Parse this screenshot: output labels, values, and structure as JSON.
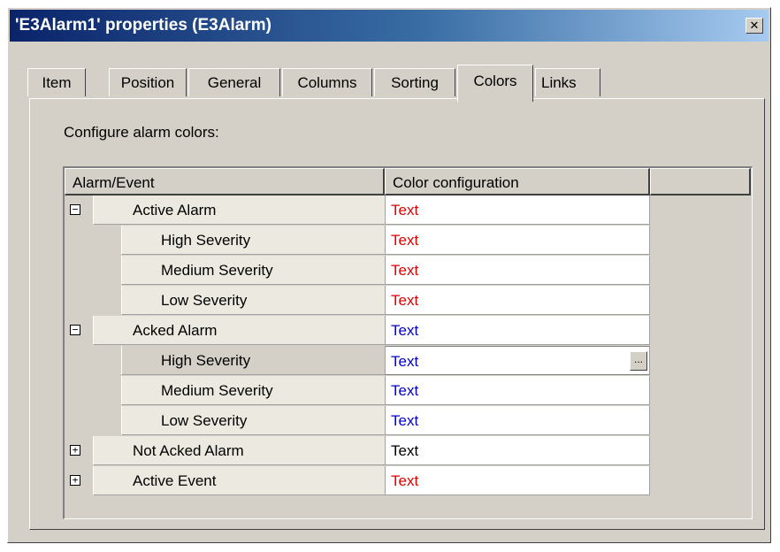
{
  "window": {
    "title": "'E3Alarm1' properties (E3Alarm)",
    "close_glyph": "✕"
  },
  "tabs": [
    {
      "label": "Item"
    },
    {
      "label": "Position"
    },
    {
      "label": "General"
    },
    {
      "label": "Columns"
    },
    {
      "label": "Sorting"
    },
    {
      "label": "Colors"
    },
    {
      "label": "Links"
    }
  ],
  "active_tab": "Colors",
  "panel": {
    "configure_label": "Configure alarm colors:"
  },
  "grid": {
    "headers": [
      "Alarm/Event",
      "Color configuration"
    ],
    "rows": [
      {
        "name": "Active Alarm",
        "level": 0,
        "expander": "−",
        "color_text": "Text",
        "color": "#e00000"
      },
      {
        "name": "High Severity",
        "level": 1,
        "color_text": "Text",
        "color": "#e00000"
      },
      {
        "name": "Medium Severity",
        "level": 1,
        "color_text": "Text",
        "color": "#e00000"
      },
      {
        "name": "Low Severity",
        "level": 1,
        "color_text": "Text",
        "color": "#e00000"
      },
      {
        "name": "Acked Alarm",
        "level": 0,
        "expander": "−",
        "color_text": "Text",
        "color": "#0000d0"
      },
      {
        "name": "High Severity",
        "level": 1,
        "color_text": "Text",
        "color": "#0000d0",
        "selected": true,
        "ellipsis": "..."
      },
      {
        "name": "Medium Severity",
        "level": 1,
        "color_text": "Text",
        "color": "#0000d0"
      },
      {
        "name": "Low Severity",
        "level": 1,
        "color_text": "Text",
        "color": "#0000d0"
      },
      {
        "name": "Not Acked Alarm",
        "level": 0,
        "expander": "+",
        "color_text": "Text",
        "color": "#000000"
      },
      {
        "name": "Active Event",
        "level": 0,
        "expander": "+",
        "color_text": "Text",
        "color": "#e00000"
      }
    ]
  }
}
